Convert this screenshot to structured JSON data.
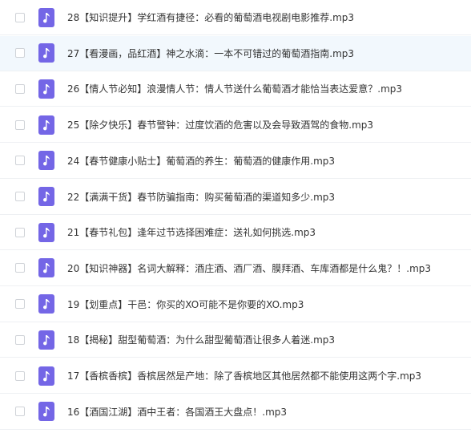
{
  "files": [
    {
      "name": "28【知识提升】学红酒有捷径：必看的葡萄酒电视剧电影推荐.mp3",
      "highlighted": false
    },
    {
      "name": "27【看漫画，品红酒】神之水滴：一本不可错过的葡萄酒指南.mp3",
      "highlighted": true
    },
    {
      "name": "26【情人节必知】浪漫情人节：情人节送什么葡萄酒才能恰当表达爱意？.mp3",
      "highlighted": false
    },
    {
      "name": "25【除夕快乐】春节警钟：过度饮酒的危害以及会导致酒驾的食物.mp3",
      "highlighted": false
    },
    {
      "name": "24【春节健康小贴士】葡萄酒的养生：葡萄酒的健康作用.mp3",
      "highlighted": false
    },
    {
      "name": "22【满满干货】春节防骗指南：购买葡萄酒的渠道知多少.mp3",
      "highlighted": false
    },
    {
      "name": "21【春节礼包】逢年过节选择困难症：送礼如何挑选.mp3",
      "highlighted": false
    },
    {
      "name": "20【知识神器】名词大解释：酒庄酒、酒厂酒、膜拜酒、车库酒都是什么鬼？！.mp3",
      "highlighted": false
    },
    {
      "name": "19【划重点】干邑：你买的XO可能不是你要的XO.mp3",
      "highlighted": false
    },
    {
      "name": "18【揭秘】甜型葡萄酒：为什么甜型葡萄酒让很多人着迷.mp3",
      "highlighted": false
    },
    {
      "name": "17【香槟香槟】香槟居然是产地：除了香槟地区其他居然都不能使用这两个字.mp3",
      "highlighted": false
    },
    {
      "name": "16【酒国江湖】酒中王者：各国酒王大盘点！.mp3",
      "highlighted": false
    }
  ],
  "icon": "music-note-icon",
  "colors": {
    "icon_bg": "#7466e6",
    "highlight_bg": "#f2f8fd",
    "text": "#333333"
  }
}
